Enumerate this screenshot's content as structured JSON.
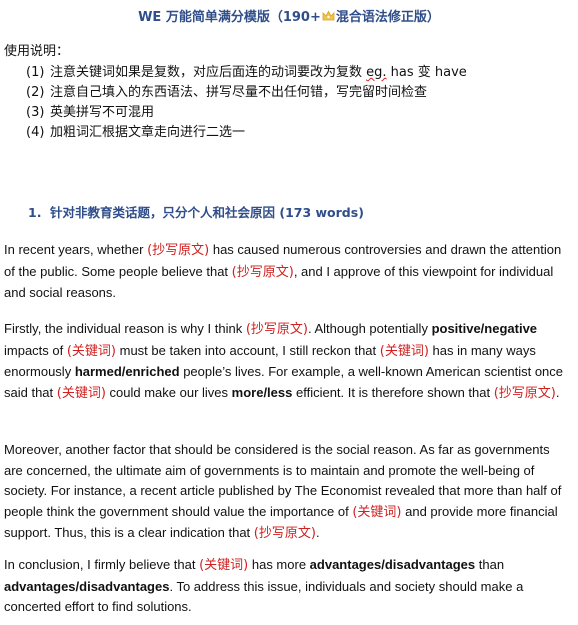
{
  "document": {
    "title_before": "WE 万能简单满分模版（190+",
    "title_after": "混合语法修正版）",
    "title_icon": "crown-icon",
    "usage_heading": "使用说明：",
    "usage_items": [
      {
        "num": "(1)",
        "text_before": "注意关键词如果是复数，对应后面连的动词要改为复数 ",
        "marked": "eg.",
        "text_after": " has 变 have"
      },
      {
        "num": "(2)",
        "text": "注意自己填入的东西语法、拼写尽量不出任何错，写完留时间检查"
      },
      {
        "num": "(3)",
        "text": "英美拼写不可混用"
      },
      {
        "num": "(4)",
        "text": "加粗词汇根据文章走向进行二选一"
      }
    ],
    "section": {
      "number": "1.",
      "heading": "针对非教育类话题，只分个人和社会原因 (173 words)"
    },
    "placeholders": {
      "copy": "(抄写原文)",
      "keyword": "(关键词)"
    },
    "paragraphs": {
      "p1": {
        "s1": "In recent years, whether ",
        "s2": " has caused numerous controversies and drawn the attention of the public. Some people believe that ",
        "s3": ", and I approve of this viewpoint for individual and social reasons."
      },
      "p2": {
        "s1": "Firstly, the individual reason is why I think ",
        "s2": ". Although potentially ",
        "b1": "positive/negative",
        "s3": " impacts of ",
        "s4": " must be taken into account, I still reckon that ",
        "s5": " has in many ways enormously ",
        "b2": "harmed/enriched",
        "s6": " people’s lives. For example, a well-known American scientist once said that ",
        "s7": " could make our lives ",
        "b3": "more/less",
        "s8": " efficient. It is therefore shown that ",
        "s9": "."
      },
      "p3": {
        "s1": "Moreover, another factor that should be considered is the social reason. As far as governments are concerned, the ultimate aim of governments is to maintain and promote the well-being of society. For instance, a recent article published by The Economist revealed that more than half of people think the government should value the importance of ",
        "s2": " and provide more financial support. Thus, this is a clear indication that ",
        "s3": "."
      },
      "p4": {
        "s1": "In conclusion, I firmly believe that ",
        "s2": " has more ",
        "b1": "advantages/disadvantages",
        "s3": " than ",
        "b2": "advantages/disadvantages",
        "s4": ". To address this issue, individuals and society should make a concerted effort to find solutions."
      }
    },
    "colors": {
      "heading_blue": "#2f4e8a",
      "placeholder_red": "#d02020",
      "body_text": "#111111"
    }
  }
}
